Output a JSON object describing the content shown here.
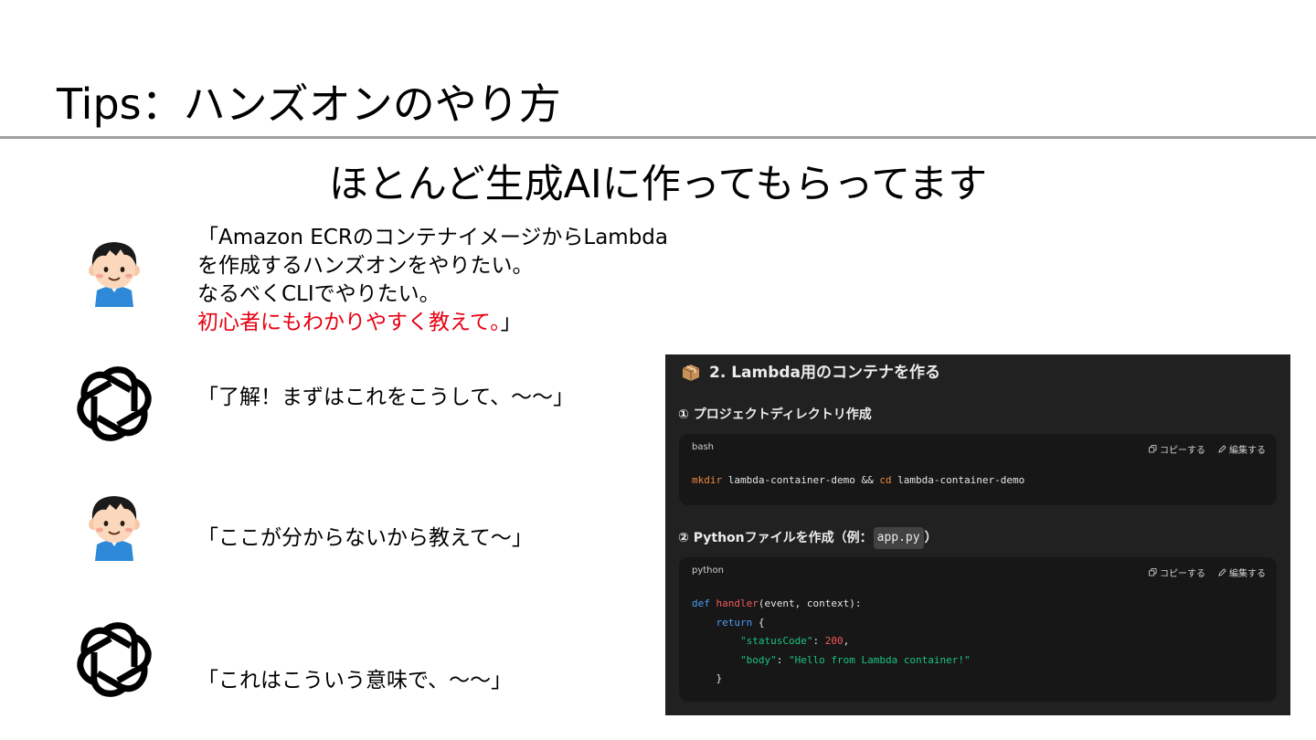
{
  "slide": {
    "title": "Tips：ハンズオンのやり方",
    "subtitle": "ほとんど生成AIに作ってもらってます"
  },
  "conversation": [
    {
      "speaker": "user",
      "lines": [
        "「Amazon ECRのコンテナイメージからLambda",
        "を作成するハンズオンをやりたい。",
        "なるべくCLIでやりたい。"
      ],
      "highlight": "初心者にもわかりやすく教えて。",
      "highlight_end": "」",
      "highlight_color": "#e60012"
    },
    {
      "speaker": "ai",
      "text": "「了解！まずはこれをこうして、～～」"
    },
    {
      "speaker": "user",
      "text": "「ここが分からないから教えて～」"
    },
    {
      "speaker": "ai",
      "text": "「これはこういう意味で、～～」"
    }
  ],
  "chat_screenshot": {
    "background": "#212121",
    "heading": "2. Lambda用のコンテナを作る",
    "step1": {
      "label": "① プロジェクトディレクトリ作成",
      "block": {
        "language": "bash",
        "copy_label": "コピーする",
        "edit_label": "編集する",
        "tokens": {
          "cmd1": "mkdir",
          "arg1": " lambda-container-demo && ",
          "cmd2": "cd",
          "arg2": " lambda-container-demo"
        }
      }
    },
    "step2": {
      "label_prefix": "② Pythonファイルを作成（例：",
      "label_code": "app.py",
      "label_suffix": "）",
      "block": {
        "language": "python",
        "copy_label": "コピーする",
        "edit_label": "編集する",
        "tokens": {
          "def": "def",
          "fn": "handler",
          "params": "(event, context):",
          "ret": "return",
          "brace_open": " {",
          "k1": "\"statusCode\"",
          "colon1": ": ",
          "v1": "200",
          "comma1": ",",
          "k2": "\"body\"",
          "colon2": ": ",
          "v2": "\"Hello from Lambda container!\"",
          "brace_close": "}"
        }
      }
    },
    "colors": {
      "command": "#f0883e",
      "keyword": "#4f9cf9",
      "function": "#f25a5a",
      "string": "#19c37d",
      "number": "#f25a5a"
    },
    "icons": [
      "package-icon",
      "copy-icon",
      "edit-icon"
    ]
  },
  "avatars": [
    "user-avatar-icon",
    "openai-logo-icon"
  ]
}
